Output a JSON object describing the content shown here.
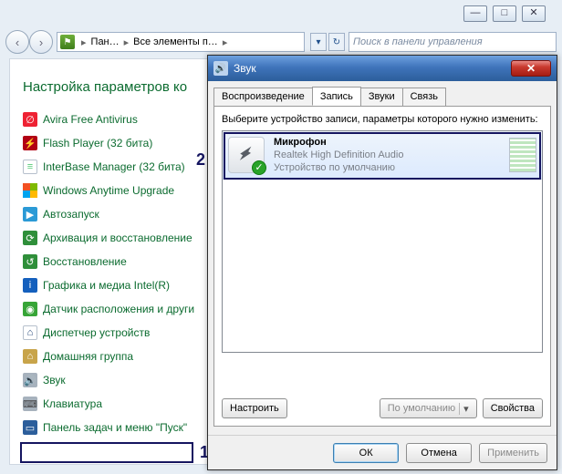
{
  "window_controls": {
    "min": "—",
    "max": "□",
    "close": "✕"
  },
  "nav": {
    "back": "‹",
    "fwd": "›"
  },
  "breadcrumb": {
    "root": "Пан…",
    "node": "Все элементы п…",
    "dropdown": "▾",
    "refresh": "↻"
  },
  "search": {
    "placeholder": "Поиск в панели управления"
  },
  "heading": "Настройка параметров ко",
  "items": [
    {
      "label": "Avira Free Antivirus",
      "icon": "avira"
    },
    {
      "label": "Flash Player (32 бита)",
      "icon": "flash"
    },
    {
      "label": "InterBase Manager (32 бита)",
      "icon": "ibase"
    },
    {
      "label": "Windows Anytime Upgrade",
      "icon": "win"
    },
    {
      "label": "Автозапуск",
      "icon": "auto"
    },
    {
      "label": "Архивация и восстановление",
      "icon": "arch"
    },
    {
      "label": "Восстановление",
      "icon": "restore"
    },
    {
      "label": "Графика и медиа Intel(R)",
      "icon": "intel"
    },
    {
      "label": "Датчик расположения и други",
      "icon": "loc"
    },
    {
      "label": "Диспетчер устройств",
      "icon": "dev"
    },
    {
      "label": "Домашняя группа",
      "icon": "home"
    },
    {
      "label": "Звук",
      "icon": "sound"
    },
    {
      "label": "Клавиатура",
      "icon": "kbd"
    },
    {
      "label": "Панель задач и меню \"Пуск\"",
      "icon": "tbar"
    }
  ],
  "annotations": {
    "n1": "1",
    "n2": "2"
  },
  "dialog": {
    "title": "Звук",
    "close_glyph": "✕",
    "tabs": [
      "Воспроизведение",
      "Запись",
      "Звуки",
      "Связь"
    ],
    "active_tab_index": 1,
    "instruction": "Выберите устройство записи, параметры которого нужно изменить:",
    "device": {
      "name": "Микрофон",
      "driver": "Realtek High Definition Audio",
      "status": "Устройство по умолчанию",
      "check": "✓"
    },
    "config_btn": "Настроить",
    "default_btn": "По умолчанию",
    "default_caret": "▾",
    "props_btn": "Свойства",
    "ok": "ОК",
    "cancel": "Отмена",
    "apply": "Применить"
  }
}
